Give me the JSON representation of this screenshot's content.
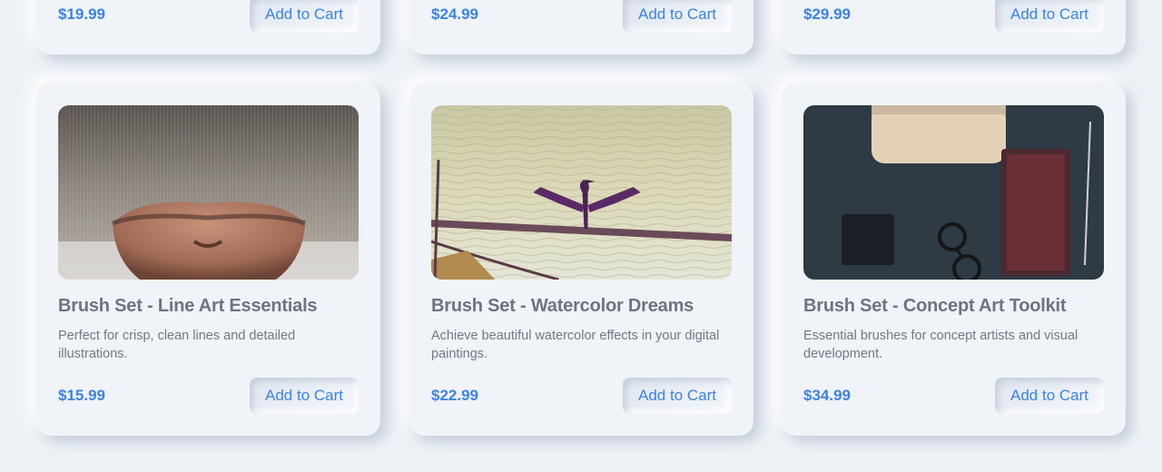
{
  "products_top": [
    {
      "price": "$19.99",
      "button": "Add to Cart"
    },
    {
      "price": "$24.99",
      "button": "Add to Cart"
    },
    {
      "price": "$29.99",
      "button": "Add to Cart"
    }
  ],
  "products": [
    {
      "image": "cat-nose-closeup",
      "title": "Brush Set - Line Art Essentials",
      "description": "Perfect for crisp, clean lines and detailed illustrations.",
      "price": "$15.99",
      "button": "Add to Cart"
    },
    {
      "image": "cormorant-on-water",
      "title": "Brush Set - Watercolor Dreams",
      "description": "Achieve beautiful watercolor effects in your digital paintings.",
      "price": "$22.99",
      "button": "Add to Cart"
    },
    {
      "image": "desk-flatlay",
      "title": "Brush Set - Concept Art Toolkit",
      "description": "Essential brushes for concept artists and visual development.",
      "price": "$34.99",
      "button": "Add to Cart"
    }
  ],
  "colors": {
    "background": "#eef2f7",
    "accent": "#3b82e6",
    "title": "#6b7482"
  }
}
